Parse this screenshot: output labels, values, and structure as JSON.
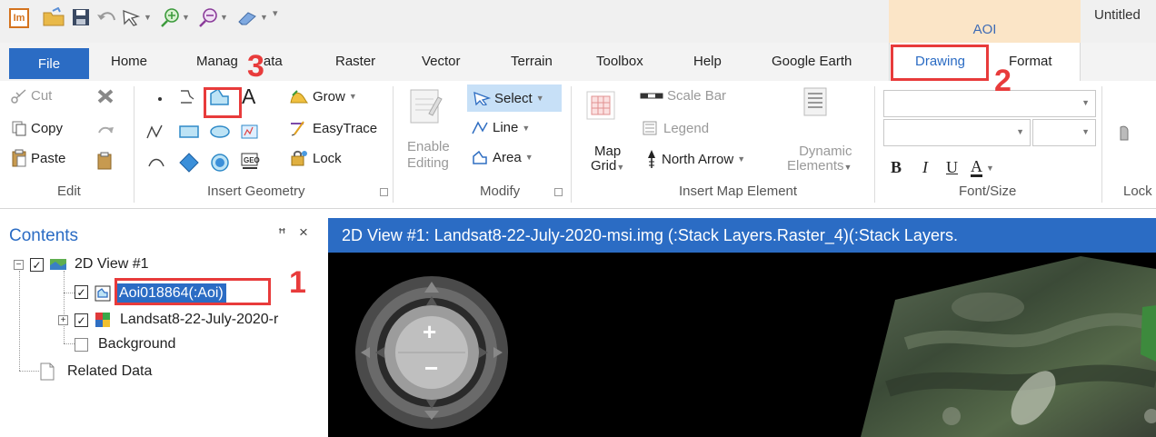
{
  "quick_access": {
    "app_logo": "Im",
    "icons": [
      "open-icon",
      "save-icon",
      "undo-icon",
      "select-icon",
      "zoom-in-icon",
      "zoom-out-icon",
      "eraser-icon",
      "customize-icon"
    ]
  },
  "context_tab": "AOI",
  "window_title": "Untitled",
  "tabs": {
    "file": "File",
    "home": "Home",
    "manage_data": "Manag",
    "manage_data_tail": "ata",
    "raster": "Raster",
    "vector": "Vector",
    "terrain": "Terrain",
    "toolbox": "Toolbox",
    "help": "Help",
    "google_earth": "Google Earth",
    "drawing": "Drawing",
    "format": "Format"
  },
  "ribbon": {
    "edit": {
      "cut": "Cut",
      "copy": "Copy",
      "paste": "Paste",
      "label": "Edit"
    },
    "insert_geometry": {
      "grow": "Grow",
      "easytrace": "EasyTrace",
      "lock": "Lock",
      "label": "Insert Geometry",
      "text_tool": "A"
    },
    "modify": {
      "enable": "Enable",
      "editing": "Editing",
      "select": "Select",
      "line": "Line",
      "area": "Area",
      "label": "Modify"
    },
    "insert_map_element": {
      "map": "Map",
      "grid": "Grid",
      "scale_bar": "Scale Bar",
      "legend": "Legend",
      "north_arrow": "North Arrow",
      "dynamic": "Dynamic",
      "elements": "Elements",
      "label": "Insert Map Element"
    },
    "font_size": {
      "bold": "B",
      "italic": "I",
      "underline": "U",
      "color": "A",
      "label": "Font/Size"
    },
    "lock": {
      "label": "Lock"
    }
  },
  "contents": {
    "title": "Contents",
    "pin": "ꟸ",
    "close": "×",
    "view_node": "2D View #1",
    "aoi_node": "Aoi018864(:Aoi)",
    "raster_node": "Landsat8-22-July-2020-r",
    "background_node": "Background",
    "related_node": "Related Data"
  },
  "view": {
    "title": "2D View #1: Landsat8-22-July-2020-msi.img (:Stack Layers.Raster_4)(:Stack Layers.",
    "zoom_in": "+",
    "zoom_out": "−"
  },
  "annotations": {
    "step1": "1",
    "step2": "2",
    "step3": "3"
  },
  "colors": {
    "accent": "#2b6cc4",
    "annotation": "#e83b3b",
    "context_tab": "#fbe5c7"
  }
}
